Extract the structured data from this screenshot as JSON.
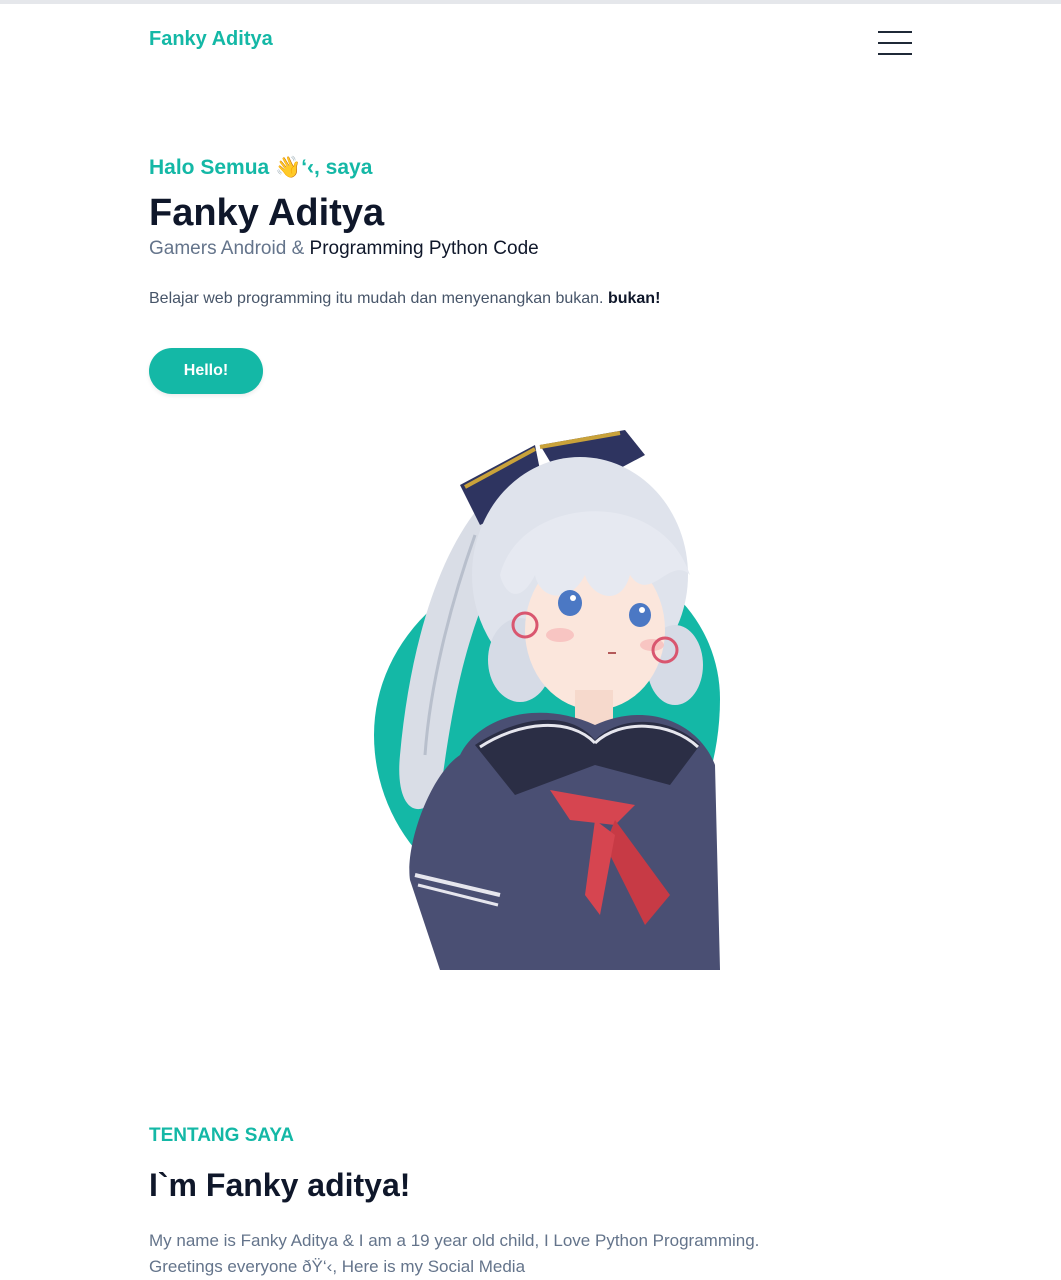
{
  "navbar": {
    "brand": "Fanky Aditya",
    "menu_icon": "hamburger-menu-icon"
  },
  "hero": {
    "greeting": "Halo Semua 👋‘‹, saya",
    "name": "Fanky Aditya",
    "subtitle_plain": "Gamers Android & ",
    "subtitle_strong": "Programming Python Code",
    "lead_plain": "Belajar web programming itu mudah dan menyenangkan bukan. ",
    "lead_strong": "bukan!",
    "button_label": "Hello!"
  },
  "about": {
    "label": "TENTANG SAYA",
    "title": "I`m Fanky aditya!",
    "text": "My name is Fanky Aditya & I am a 19 year old child, I Love Python Programming. Greetings everyone ðŸ‘‹, Here is my Social Media"
  },
  "colors": {
    "accent": "#14b8a6",
    "heading": "#0f172a",
    "muted": "#64748b"
  }
}
